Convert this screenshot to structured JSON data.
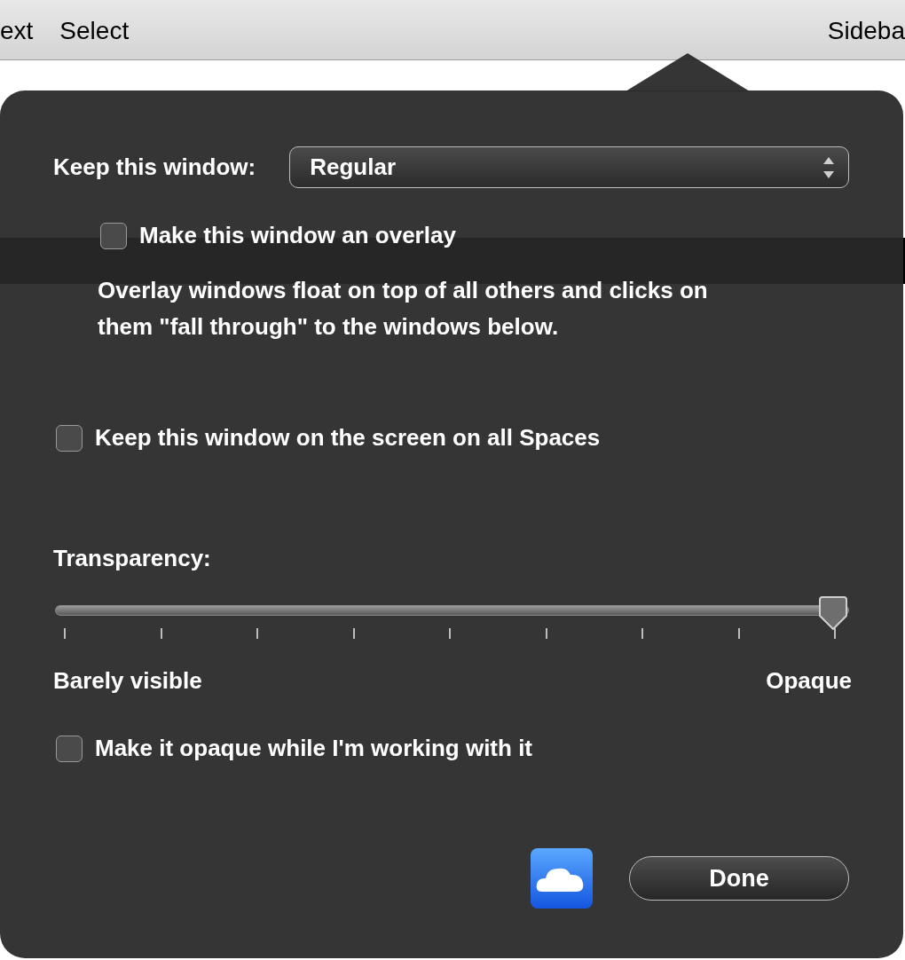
{
  "toolbar": {
    "items": [
      {
        "label": "ext"
      },
      {
        "label": "Select"
      },
      {
        "label": "Sideba"
      }
    ]
  },
  "popover": {
    "keep_window": {
      "label": "Keep this window:",
      "value": "Regular",
      "overlay": {
        "label": "Make this window an overlay",
        "checked": false
      },
      "note": "Overlay windows float on top of all others and clicks on them \"fall through\" to the windows below."
    },
    "all_spaces": {
      "label": "Keep this window on the screen on all Spaces",
      "checked": false
    },
    "transparency": {
      "label": "Transparency:",
      "level": 1,
      "min_label": "Barely visible",
      "max_label": "Opaque",
      "opaque_while_working": {
        "label": "Make it opaque while I'm working with it",
        "checked": false
      }
    },
    "done_button": {
      "label": "Done"
    }
  }
}
